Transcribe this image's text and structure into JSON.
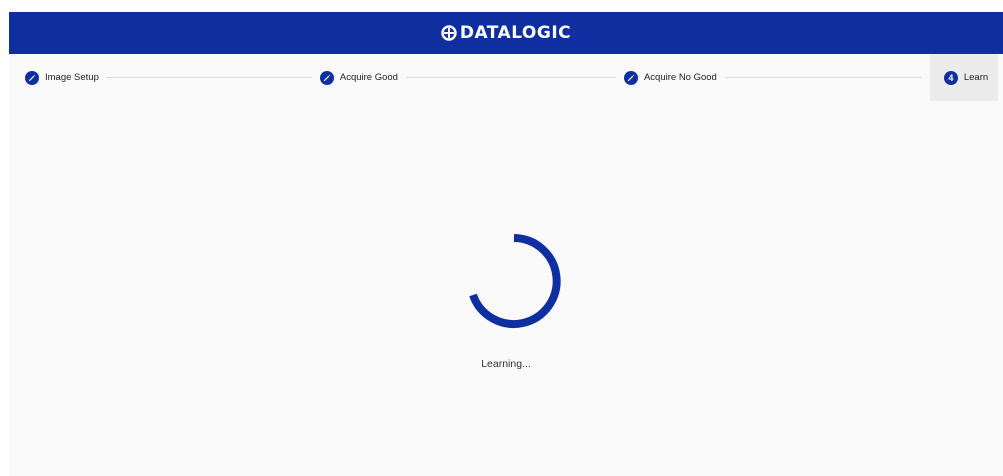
{
  "brand": {
    "name": "DATALOGIC",
    "color": "#0f2fa0"
  },
  "stepper": {
    "steps": [
      {
        "label": "Image Setup",
        "state": "completed",
        "icon": "pencil-icon"
      },
      {
        "label": "Acquire Good",
        "state": "completed",
        "icon": "pencil-icon"
      },
      {
        "label": "Acquire No Good",
        "state": "completed",
        "icon": "pencil-icon"
      },
      {
        "label": "Learn",
        "state": "active",
        "number": "4"
      }
    ]
  },
  "main": {
    "status_text": "Learning...",
    "spinner_icon": "loading-spinner-icon"
  }
}
